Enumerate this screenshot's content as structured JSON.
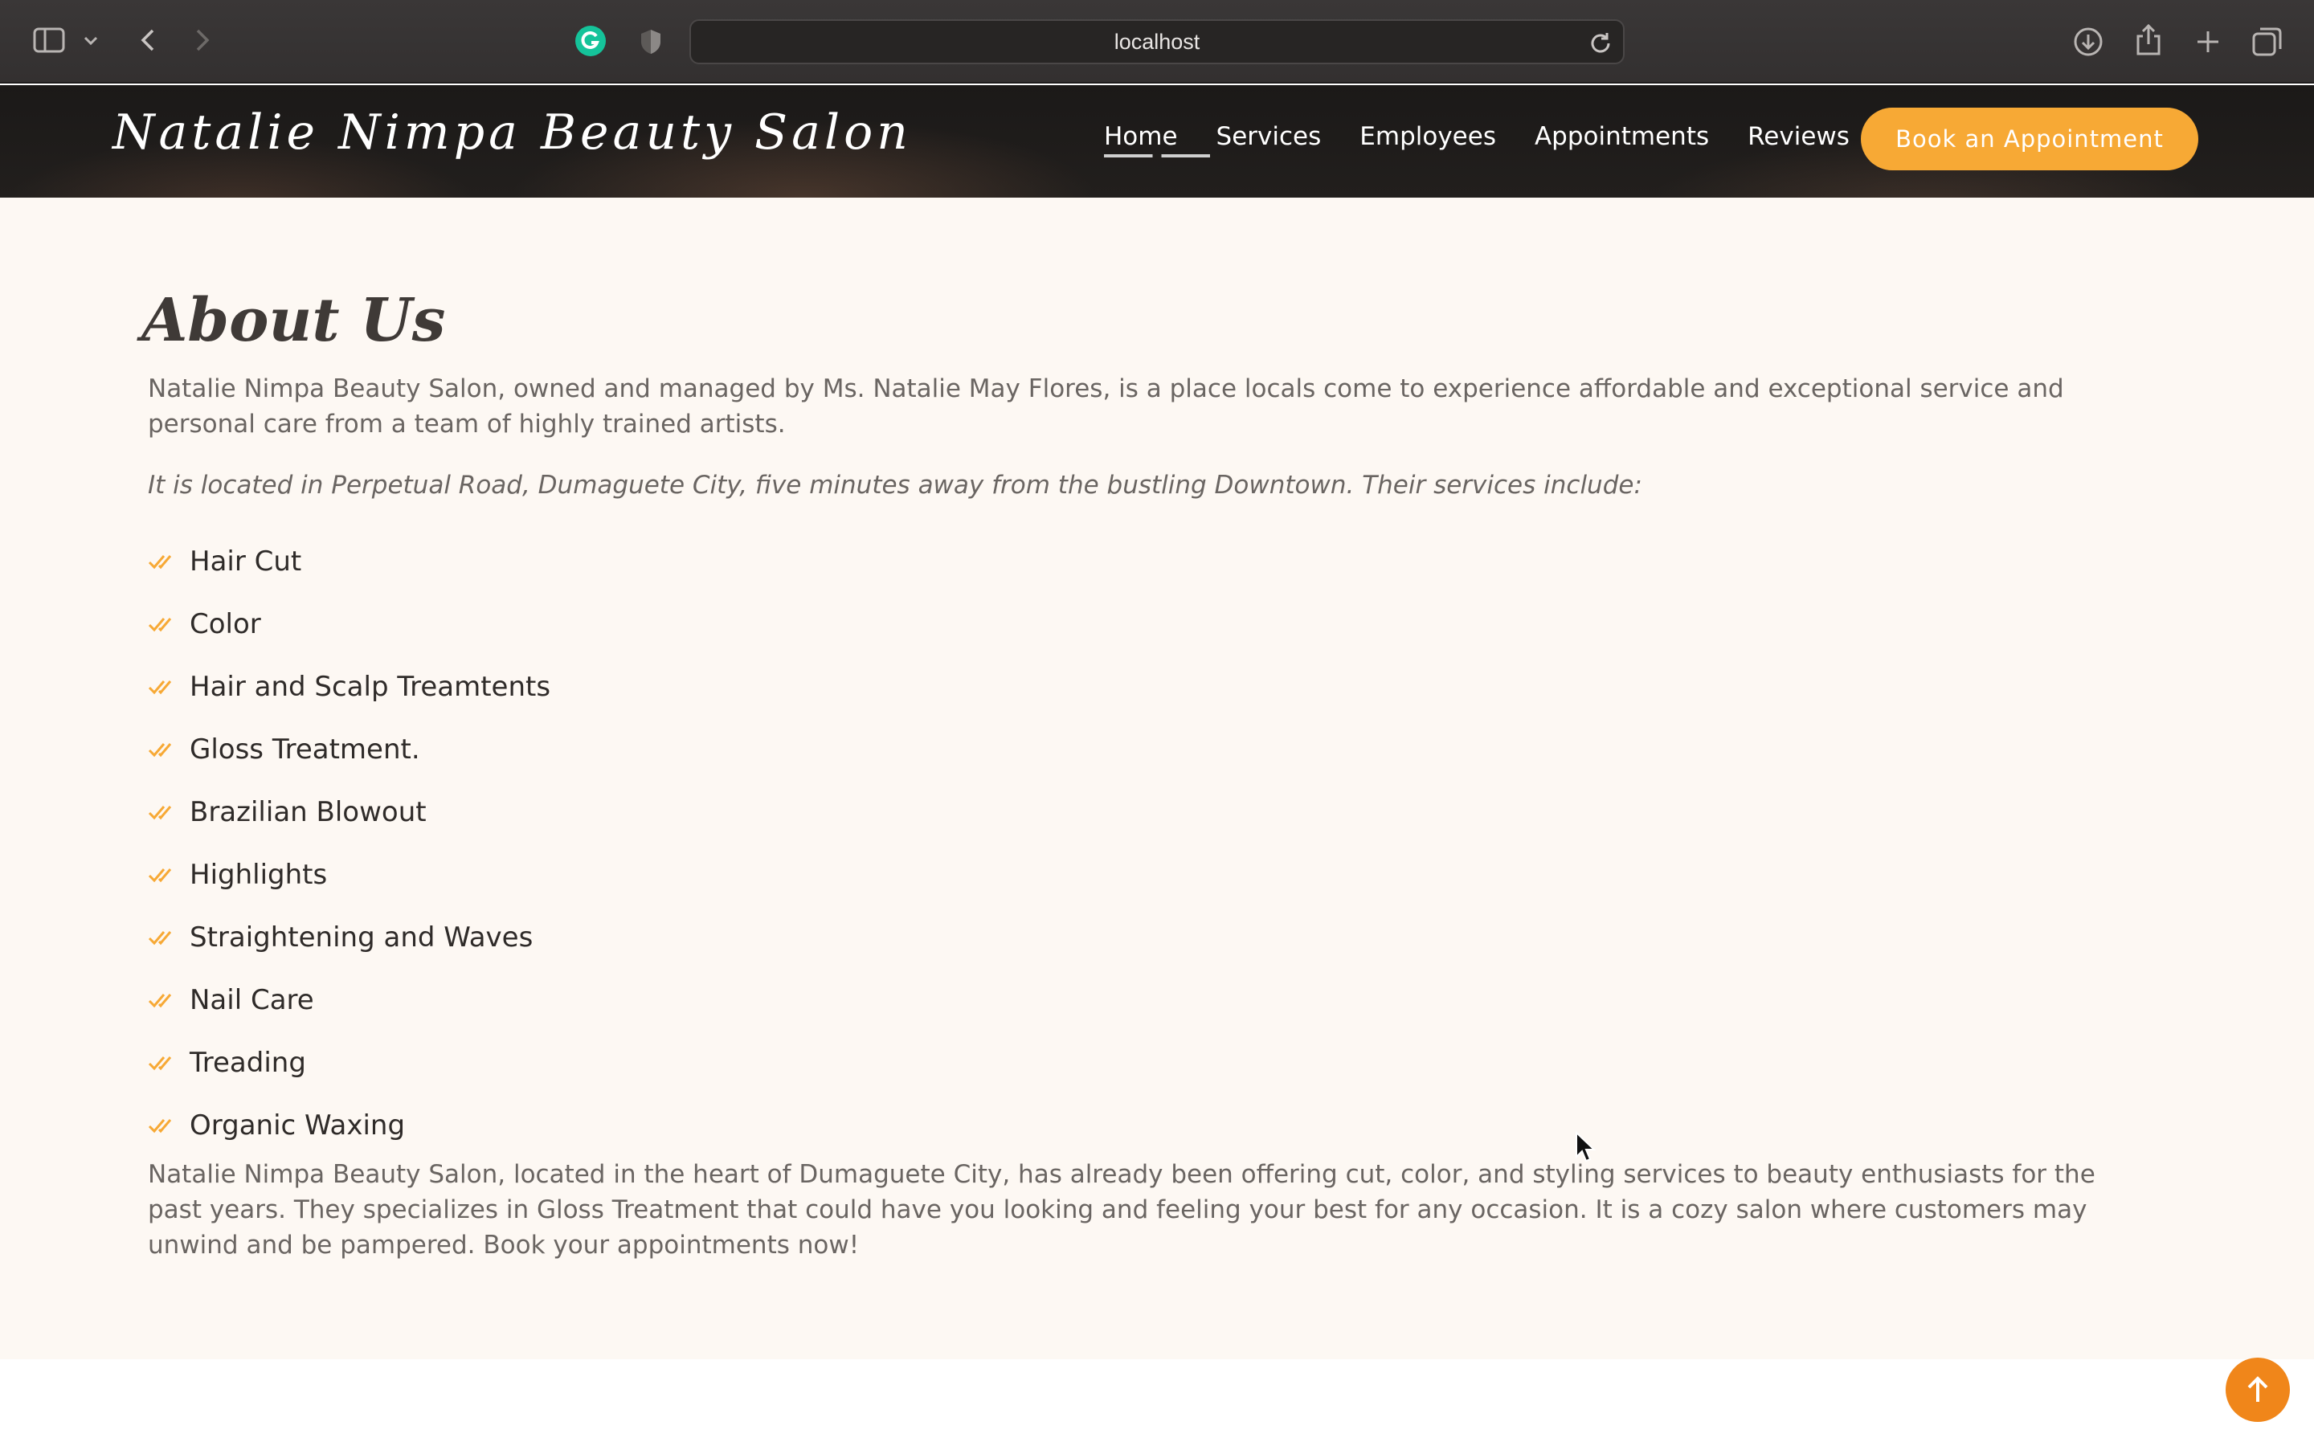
{
  "browser": {
    "url": "localhost",
    "icons": [
      "sidebar-icon",
      "chevron-down-icon",
      "back-icon",
      "forward-icon",
      "grammarly-icon",
      "shield-icon",
      "reload-icon",
      "download-icon",
      "share-icon",
      "new-tab-icon",
      "tabs-overview-icon"
    ]
  },
  "header": {
    "brand": "Natalie Nimpa Beauty Salon",
    "nav": [
      {
        "label": "Home",
        "active": true
      },
      {
        "label": "Services"
      },
      {
        "label": "Employees"
      },
      {
        "label": "Appointments"
      },
      {
        "label": "Reviews"
      }
    ],
    "cta": "Book an Appointment"
  },
  "about": {
    "title": "About Us",
    "intro": "Natalie Nimpa Beauty Salon, owned and managed by Ms. Natalie May Flores, is a place locals come to experience affordable and exceptional service and personal care from a team of highly trained artists.",
    "location": "It is located in Perpetual Road, Dumaguete City, five minutes away from the bustling Downtown. Their services include:",
    "services": [
      "Hair Cut",
      "Color",
      "Hair and Scalp Treamtents",
      "Gloss Treatment.",
      "Brazilian Blowout",
      "Highlights",
      "Straightening and Waves",
      "Nail Care",
      "Treading",
      "Organic Waxing"
    ],
    "closing": "Natalie Nimpa Beauty Salon, located in the heart of Dumaguete City, has already been offering cut, color, and styling services to beauty enthusiasts for the past years. They specializes in Gloss Treatment that could have you looking and feeling your best for any occasion. It is a cozy salon where customers may unwind and be pampered. Book your appointments now!"
  },
  "colors": {
    "accent": "#f7a935",
    "back_to_top": "#f0861a",
    "page_bg": "#fdf8f3",
    "header_bg": "#1f1c1b"
  }
}
